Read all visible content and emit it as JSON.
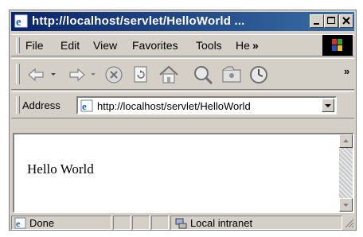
{
  "window": {
    "title": "http://localhost/servlet/HelloWorld ..."
  },
  "menu": {
    "items": [
      {
        "label": "File"
      },
      {
        "label": "Edit"
      },
      {
        "label": "View"
      },
      {
        "label": "Favorites"
      },
      {
        "label": "Tools"
      },
      {
        "label": "He"
      }
    ],
    "overflow": "»"
  },
  "toolbar": {
    "buttons": [
      "back-icon",
      "forward-icon",
      "stop-icon",
      "refresh-icon",
      "home-icon",
      "search-icon",
      "favorites-icon",
      "history-icon"
    ],
    "overflow": "»"
  },
  "address": {
    "label": "Address",
    "url": "http://localhost/servlet/HelloWorld"
  },
  "page": {
    "text": "Hello World"
  },
  "status": {
    "text": "Done",
    "zone": "Local intranet"
  }
}
